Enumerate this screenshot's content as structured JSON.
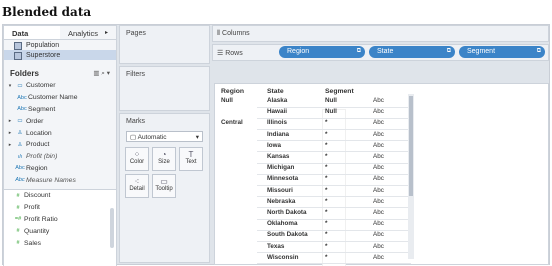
{
  "title": "Blended data",
  "sidebar": {
    "tabs": [
      {
        "label": "Data"
      },
      {
        "label": "Analytics"
      }
    ],
    "datasources": [
      {
        "label": "Population"
      },
      {
        "label": "Superstore"
      }
    ],
    "folders_label": "Folders",
    "dimensions": [
      {
        "label": "Customer",
        "icon": "folder"
      },
      {
        "label": "Customer Name",
        "icon": "Abc"
      },
      {
        "label": "Segment",
        "icon": "Abc"
      },
      {
        "label": "Order",
        "icon": "folder"
      },
      {
        "label": "Location",
        "icon": "hierarchy"
      },
      {
        "label": "Product",
        "icon": "hierarchy"
      },
      {
        "label": "Profit (bin)",
        "icon": "bin"
      },
      {
        "label": "Region",
        "icon": "Abc"
      },
      {
        "label": "Measure Names",
        "icon": "Abc"
      }
    ],
    "measures": [
      {
        "label": "Discount"
      },
      {
        "label": "Profit"
      },
      {
        "label": "Profit Ratio"
      },
      {
        "label": "Quantity"
      },
      {
        "label": "Sales"
      }
    ]
  },
  "shelves": {
    "pages_label": "Pages",
    "filters_label": "Filters",
    "marks_label": "Marks",
    "marks_type": "Automatic",
    "marks_buttons": [
      {
        "label": "Color"
      },
      {
        "label": "Size"
      },
      {
        "label": "Text"
      },
      {
        "label": "Detail"
      },
      {
        "label": "Tooltip"
      }
    ],
    "columns_label": "Columns",
    "rows_label": "Rows",
    "row_pills": [
      {
        "label": "Region"
      },
      {
        "label": "State"
      },
      {
        "label": "Segment"
      }
    ]
  },
  "view": {
    "headers": {
      "region": "Region",
      "state": "State",
      "segment": "Segment"
    },
    "rows": [
      {
        "region": "Null",
        "state": "Alaska",
        "segment": "Null",
        "value": "Abc"
      },
      {
        "region": "",
        "state": "Hawaii",
        "segment": "Null",
        "value": "Abc"
      },
      {
        "region": "Central",
        "state": "Illinois",
        "segment": "*",
        "value": "Abc"
      },
      {
        "region": "",
        "state": "Indiana",
        "segment": "*",
        "value": "Abc"
      },
      {
        "region": "",
        "state": "Iowa",
        "segment": "*",
        "value": "Abc"
      },
      {
        "region": "",
        "state": "Kansas",
        "segment": "*",
        "value": "Abc"
      },
      {
        "region": "",
        "state": "Michigan",
        "segment": "*",
        "value": "Abc"
      },
      {
        "region": "",
        "state": "Minnesota",
        "segment": "*",
        "value": "Abc"
      },
      {
        "region": "",
        "state": "Missouri",
        "segment": "*",
        "value": "Abc"
      },
      {
        "region": "",
        "state": "Nebraska",
        "segment": "*",
        "value": "Abc"
      },
      {
        "region": "",
        "state": "North Dakota",
        "segment": "*",
        "value": "Abc"
      },
      {
        "region": "",
        "state": "Oklahoma",
        "segment": "*",
        "value": "Abc"
      },
      {
        "region": "",
        "state": "South Dakota",
        "segment": "*",
        "value": "Abc"
      },
      {
        "region": "",
        "state": "Texas",
        "segment": "*",
        "value": "Abc"
      },
      {
        "region": "",
        "state": "Wisconsin",
        "segment": "*",
        "value": "Abc"
      }
    ]
  },
  "colors": {
    "accent": "#3b84c8",
    "background": "#dfe4ea"
  }
}
